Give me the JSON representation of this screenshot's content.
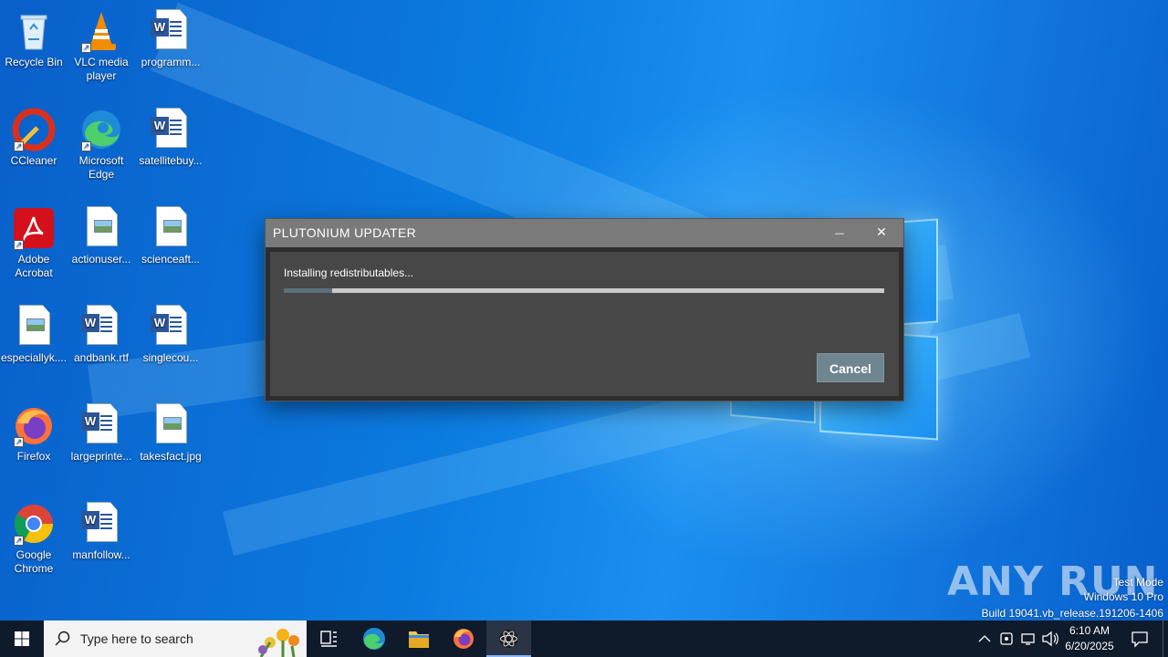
{
  "desktop": {
    "icons": [
      {
        "label": "Recycle Bin"
      },
      {
        "label": "VLC media player"
      },
      {
        "label": "programm..."
      },
      {
        "label": "CCleaner"
      },
      {
        "label": "Microsoft Edge"
      },
      {
        "label": "satellitebuy..."
      },
      {
        "label": "Adobe Acrobat"
      },
      {
        "label": "actionuser..."
      },
      {
        "label": "scienceaft..."
      },
      {
        "label": "especiallyk...."
      },
      {
        "label": "andbank.rtf"
      },
      {
        "label": "singlecou..."
      },
      {
        "label": "Firefox"
      },
      {
        "label": "largeprinte..."
      },
      {
        "label": "takesfact.jpg"
      },
      {
        "label": "Google Chrome"
      },
      {
        "label": "manfollow..."
      }
    ]
  },
  "dialog": {
    "title": "PLUTONIUM UPDATER",
    "minimize_glyph": "—",
    "close_glyph": "✕",
    "status": "Installing redistributables...",
    "progress": 0.08,
    "cancel_label": "Cancel"
  },
  "watermark": {
    "logo": "ANY RUN",
    "line1": "Test Mode",
    "line2": "Windows 10 Pro",
    "line3": "Build 19041.vb_release.191206-1406"
  },
  "taskbar": {
    "search_placeholder": "Type here to search",
    "time": "6:10 AM",
    "date": "6/20/2025",
    "colors": {
      "bg": "#0f1a2b",
      "active_underline": "#8ab4f8"
    }
  }
}
